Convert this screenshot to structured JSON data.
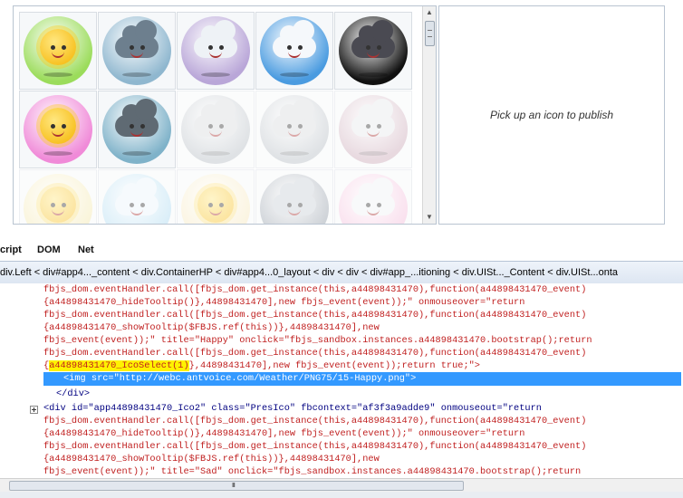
{
  "publish_panel": {
    "message": "Pick up an icon to publish"
  },
  "icons": [
    {
      "name": "happy-sun-icon",
      "kind": "sun",
      "bg": "#9bdc5b",
      "dim": false
    },
    {
      "name": "rain-cloud-icon",
      "kind": "cloud",
      "bg": "#8fb7cf",
      "cloud": "#6d7f8e",
      "dim": false
    },
    {
      "name": "sleepy-cloud-icon",
      "kind": "cloud",
      "bg": "#b9a6d8",
      "cloud": "#eef2f6",
      "dim": false
    },
    {
      "name": "smile-cloud-icon",
      "kind": "cloud",
      "bg": "#4a9be0",
      "cloud": "#f5f8fb",
      "dim": false
    },
    {
      "name": "storm-cloud-icon",
      "kind": "cloud",
      "bg": "#101010",
      "cloud": "#4a4a52",
      "dim": false
    },
    {
      "name": "love-sun-icon",
      "kind": "sun",
      "bg": "#f08ad8",
      "dim": false
    },
    {
      "name": "grey-cloud-icon",
      "kind": "cloud",
      "bg": "#7fb2c9",
      "cloud": "#5f6a73",
      "dim": false
    },
    {
      "name": "sad-cloud-icon",
      "kind": "cloud",
      "bg": "#b5bcc3",
      "cloud": "#d7dadd",
      "dim": true
    },
    {
      "name": "shy-cloud-icon",
      "kind": "cloud",
      "bg": "#b5bcc3",
      "cloud": "#d7dadd",
      "dim": true
    },
    {
      "name": "pink-cloud-icon",
      "kind": "cloud",
      "bg": "#c9a6b5",
      "cloud": "#e6e8ea",
      "dim": true
    },
    {
      "name": "peek-sun-icon",
      "kind": "sun",
      "bg": "#f3e7a8",
      "dim": true
    },
    {
      "name": "snow-cloud-icon",
      "kind": "cloud",
      "bg": "#a8d8f0",
      "cloud": "#eaf4fb",
      "dim": true
    },
    {
      "name": "fog-sun-icon",
      "kind": "sun",
      "bg": "#f6e7b9",
      "dim": true
    },
    {
      "name": "night-cloud-icon",
      "kind": "cloud",
      "bg": "#8d97a3",
      "cloud": "#c8ced6",
      "dim": true
    },
    {
      "name": "pink-sleep-cloud-icon",
      "kind": "cloud",
      "bg": "#f3b8d8",
      "cloud": "#f0f2f4",
      "dim": true
    },
    {
      "name": "cool-sun-icon",
      "kind": "sun",
      "bg": "#84b8e6",
      "dim": false
    }
  ],
  "devtools": {
    "tabs": [
      "cript",
      "DOM",
      "Net"
    ],
    "breadcrumb": "div.Left < div#app4..._content < div.ContainerHP < div#app4...0_layout < div < div < div#app_...itioning < div.UISt..._Content < div.UISt...onta",
    "code_lines": [
      "fbjs_dom.eventHandler.call([fbjs_dom.get_instance(this,a44898431470),function(a44898431470_event)",
      "{a44898431470_hideTooltip()},44898431470],new fbjs_event(event));\" onmouseover=\"return",
      "fbjs_dom.eventHandler.call([fbjs_dom.get_instance(this,a44898431470),function(a44898431470_event)",
      "{a44898431470_showTooltip($FBJS.ref(this))},44898431470],new",
      "fbjs_event(event));\" title=\"Happy\" onclick=\"fbjs_sandbox.instances.a44898431470.bootstrap();return",
      "fbjs_dom.eventHandler.call([fbjs_dom.get_instance(this,a44898431470),function(a44898431470_event)",
      "},44898431470],new fbjs_event(event));return true;\">"
    ],
    "highlight_token": "a44898431470_IcoSelect(1)",
    "selected_line": "<img src=\"http://webc.antvoice.com/Weather/PNG75/15-Happy.png\">",
    "close_div": "</div>",
    "next_lines": [
      "<div id=\"app44898431470_Ico2\" class=\"PresIco\" fbcontext=\"af3f3a9adde9\" onmouseout=\"return",
      "fbjs_dom.eventHandler.call([fbjs_dom.get_instance(this,a44898431470),function(a44898431470_event)",
      "{a44898431470_hideTooltip()},44898431470],new fbjs_event(event));\" onmouseover=\"return",
      "fbjs_dom.eventHandler.call([fbjs_dom.get_instance(this,a44898431470),function(a44898431470_event)",
      "{a44898431470_showTooltip($FBJS.ref(this))},44898431470],new",
      "fbjs_event(event));\" title=\"Sad\" onclick=\"fbjs_sandbox.instances.a44898431470.bootstrap();return"
    ]
  },
  "scrollbar": {
    "grip": "III"
  }
}
